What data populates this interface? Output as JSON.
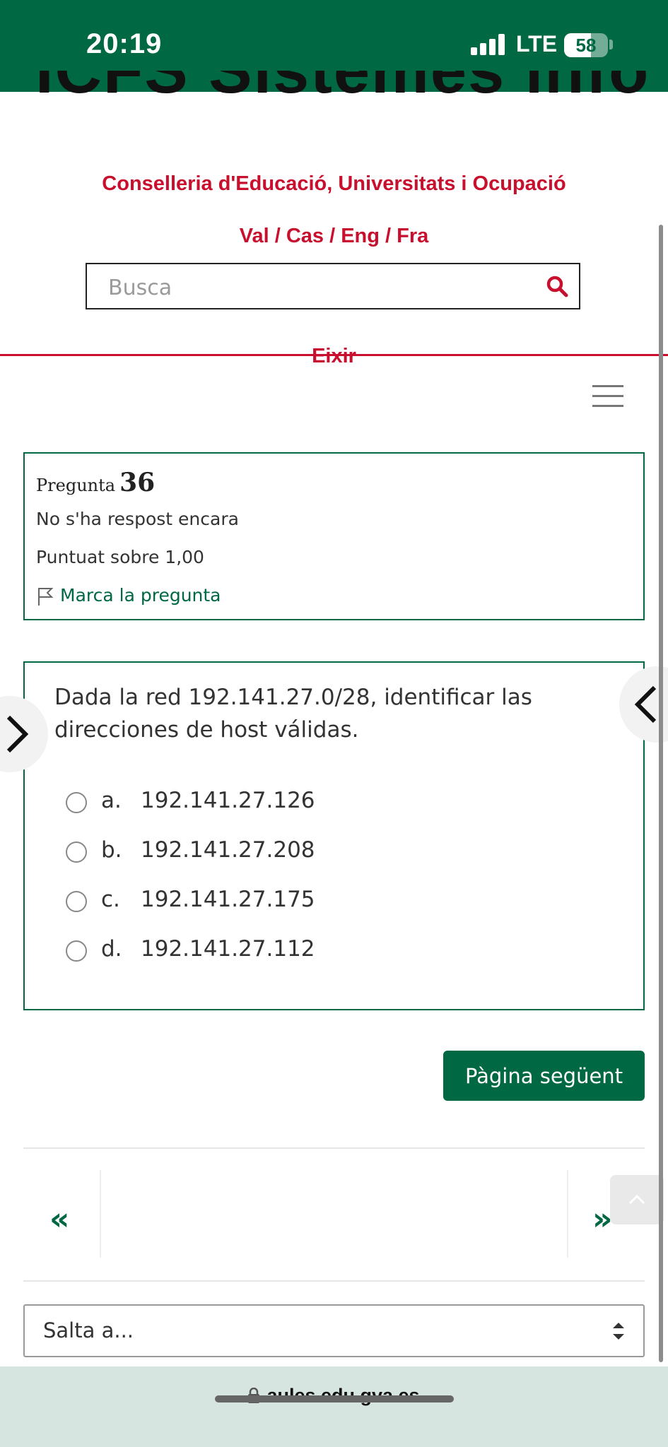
{
  "status_bar": {
    "time": "20:19",
    "network": "LTE",
    "battery": "58"
  },
  "header": {
    "clipped_title": "ICFS Sistemes inform...",
    "department": "Conselleria d'Educació, Universitats i Ocupació",
    "languages": "Val / Cas / Eng / Fra",
    "search_placeholder": "Busca",
    "logout": "Eixir"
  },
  "question": {
    "label": "Pregunta",
    "number": "36",
    "status": "No s'ha respost encara",
    "grade": "Puntuat sobre 1,00",
    "flag": "Marca la pregunta",
    "text": "Dada la red 192.141.27.0/28, identificar las direcciones de host válidas.",
    "answers": [
      {
        "letter": "a.",
        "value": "192.141.27.126"
      },
      {
        "letter": "b.",
        "value": "192.141.27.208"
      },
      {
        "letter": "c.",
        "value": "192.141.27.175"
      },
      {
        "letter": "d.",
        "value": "192.141.27.112"
      }
    ]
  },
  "navigation": {
    "next_page": "Pàgina següent",
    "prev_symbol": "«",
    "next_symbol": "»",
    "jump_to": "Salta a..."
  },
  "browser": {
    "url": "aules.edu.gva.es"
  },
  "colors": {
    "brand_green": "#006843",
    "accent_red": "#c8102e"
  }
}
